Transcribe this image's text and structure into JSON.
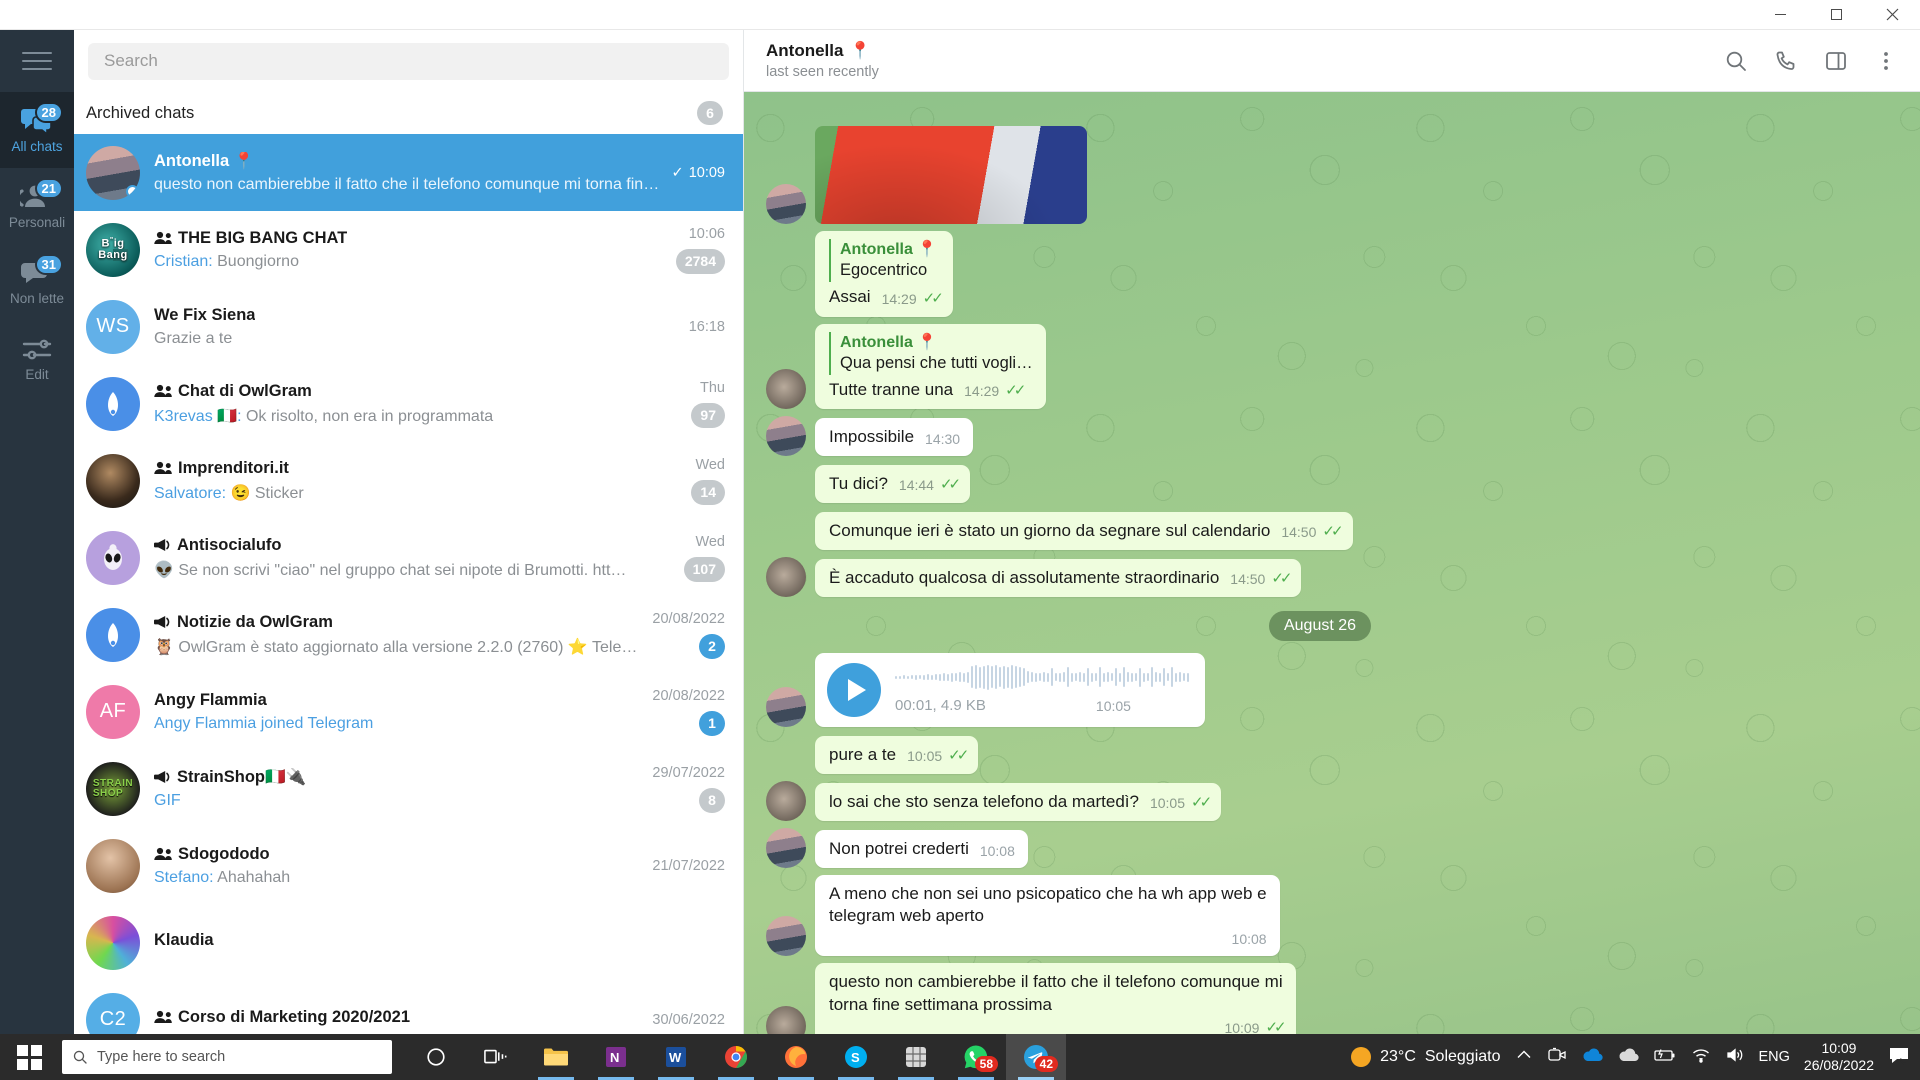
{
  "window": {
    "minimize_label": "Minimize",
    "maximize_label": "Maximize",
    "close_label": "Close"
  },
  "rail": {
    "menu_label": "Menu",
    "folders": [
      {
        "label": "All chats",
        "badge": "28",
        "icon": "chats-icon",
        "active": true
      },
      {
        "label": "Personali",
        "badge": "21",
        "icon": "person-icon",
        "active": false
      },
      {
        "label": "Non lette",
        "badge": "31",
        "icon": "unread-icon",
        "active": false
      },
      {
        "label": "Edit",
        "badge": "",
        "icon": "settings-icon",
        "active": false
      }
    ]
  },
  "search": {
    "placeholder": "Search",
    "value": ""
  },
  "archived": {
    "label": "Archived chats",
    "count": "6"
  },
  "chats": [
    {
      "name": "Antonella",
      "emoji": "📍",
      "type": "user",
      "preview": "questo non cambierebbe il fatto che il telefono comunque mi torna fine …",
      "sender": "",
      "time": "10:09",
      "badge": "",
      "badge_kind": "none",
      "selected": true,
      "read_tick": true,
      "online": true,
      "avatar_kind": "photo-antonella",
      "avatar_text": ""
    },
    {
      "name": "THE BIG BANG CHAT",
      "emoji": "",
      "type": "group",
      "preview": "Buongiorno",
      "sender": "Cristian: ",
      "time": "10:06",
      "badge": "2784",
      "badge_kind": "grey",
      "selected": false,
      "read_tick": false,
      "online": false,
      "avatar_kind": "photo-bigbang",
      "avatar_text": ""
    },
    {
      "name": "We Fix Siena",
      "emoji": "",
      "type": "user",
      "preview": "Grazie a te",
      "sender": "",
      "time": "16:18",
      "badge": "",
      "badge_kind": "none",
      "selected": false,
      "read_tick": false,
      "online": false,
      "avatar_kind": "initials-blue",
      "avatar_text": "WS"
    },
    {
      "name": "Chat di OwlGram",
      "emoji": "",
      "type": "group",
      "preview": "Ok risolto, non era in programmata",
      "sender": "K3revas 🇮🇹: ",
      "time": "Thu",
      "badge": "97",
      "badge_kind": "grey",
      "selected": false,
      "read_tick": false,
      "online": false,
      "avatar_kind": "owl",
      "avatar_text": ""
    },
    {
      "name": "Imprenditori.it",
      "emoji": "",
      "type": "group",
      "preview": "😉 Sticker",
      "sender": "Salvatore: ",
      "time": "Wed",
      "badge": "14",
      "badge_kind": "grey",
      "selected": false,
      "read_tick": false,
      "online": false,
      "avatar_kind": "photo-man",
      "avatar_text": ""
    },
    {
      "name": "Antisocialufo",
      "emoji": "",
      "type": "channel",
      "preview": "👽 Se non scrivi \"ciao\" nel gruppo chat sei nipote di Brumotti.  htt…",
      "sender": "",
      "time": "Wed",
      "badge": "107",
      "badge_kind": "grey",
      "selected": false,
      "read_tick": false,
      "online": false,
      "avatar_kind": "alien",
      "avatar_text": ""
    },
    {
      "name": "Notizie da OwlGram",
      "emoji": "",
      "type": "channel",
      "preview": "🦉 OwlGram è stato aggiornato alla versione 2.2.0 (2760) ⭐ Telegr…",
      "sender": "",
      "time": "20/08/2022",
      "badge": "2",
      "badge_kind": "blue",
      "selected": false,
      "read_tick": false,
      "online": false,
      "avatar_kind": "owl",
      "avatar_text": ""
    },
    {
      "name": "Angy Flammia",
      "emoji": "",
      "type": "user",
      "preview": "Angy Flammia joined Telegram",
      "sender": "",
      "preview_blue": true,
      "time": "20/08/2022",
      "badge": "1",
      "badge_kind": "blue",
      "selected": false,
      "read_tick": false,
      "online": false,
      "avatar_kind": "initials-pink",
      "avatar_text": "AF"
    },
    {
      "name": "StrainShop🇮🇹🔌",
      "emoji": "",
      "type": "channel",
      "preview": "GIF",
      "sender": "",
      "preview_blue": true,
      "time": "29/07/2022",
      "badge": "8",
      "badge_kind": "grey",
      "selected": false,
      "read_tick": false,
      "online": false,
      "avatar_kind": "strain",
      "avatar_text": ""
    },
    {
      "name": "Sdogododo",
      "emoji": "",
      "type": "group",
      "preview": "Ahahahah",
      "sender": "Stefano: ",
      "time": "21/07/2022",
      "badge": "",
      "badge_kind": "none",
      "selected": false,
      "read_tick": false,
      "online": false,
      "avatar_kind": "photo-head",
      "avatar_text": ""
    },
    {
      "name": "Klaudia",
      "emoji": "",
      "type": "user",
      "preview": "",
      "sender": "",
      "time": "",
      "badge": "",
      "badge_kind": "none",
      "selected": false,
      "read_tick": false,
      "online": false,
      "avatar_kind": "photo-klaudia",
      "avatar_text": ""
    },
    {
      "name": "Corso di Marketing 2020/2021",
      "emoji": "",
      "type": "group",
      "preview": "",
      "sender": "",
      "time": "30/06/2022",
      "badge": "",
      "badge_kind": "none",
      "selected": false,
      "read_tick": false,
      "online": false,
      "avatar_kind": "initials-blue2",
      "avatar_text": "C2"
    }
  ],
  "conversation": {
    "title": "Antonella",
    "title_emoji": "📍",
    "status": "last seen recently",
    "actions": [
      "search-icon",
      "phone-icon",
      "panel-icon",
      "more-icon"
    ],
    "messages": [
      {
        "kind": "photo",
        "dir": "in",
        "avatar": true
      },
      {
        "kind": "text",
        "dir": "out",
        "avatar": false,
        "reply_name": "Antonella",
        "reply_emoji": "📍",
        "reply_text": "Egocentrico",
        "text": "Assai",
        "time": "14:29",
        "ticks": true
      },
      {
        "kind": "text",
        "dir": "out",
        "avatar": true,
        "avatar_kind": "cat",
        "reply_name": "Antonella",
        "reply_emoji": "📍",
        "reply_text": "Qua pensi che tutti vogli…",
        "text": "Tutte tranne una",
        "time": "14:29",
        "ticks": true
      },
      {
        "kind": "text",
        "dir": "in",
        "avatar": true,
        "avatar_kind": "girl",
        "text": "Impossibile",
        "time": "14:30",
        "ticks": false
      },
      {
        "kind": "text",
        "dir": "out",
        "avatar": false,
        "text": "Tu dici?",
        "time": "14:44",
        "ticks": true
      },
      {
        "kind": "text",
        "dir": "out",
        "avatar": false,
        "wide": true,
        "text": "Comunque ieri è stato un giorno da segnare sul calendario",
        "time": "14:50",
        "ticks": true
      },
      {
        "kind": "text",
        "dir": "out",
        "avatar": true,
        "avatar_kind": "cat",
        "wide": true,
        "text": "È accaduto qualcosa di assolutamente straordinario",
        "time": "14:50",
        "ticks": true
      },
      {
        "kind": "date",
        "label": "August 26"
      },
      {
        "kind": "voice",
        "dir": "in",
        "avatar": true,
        "avatar_kind": "girl",
        "duration": "00:01, 4.9 KB",
        "time": "10:05"
      },
      {
        "kind": "text",
        "dir": "out",
        "avatar": false,
        "text": "pure a te",
        "time": "10:05",
        "ticks": true
      },
      {
        "kind": "text",
        "dir": "out",
        "avatar": true,
        "avatar_kind": "cat",
        "text": "lo sai che sto senza telefono da martedì?",
        "time": "10:05",
        "ticks": true
      },
      {
        "kind": "text",
        "dir": "in",
        "avatar": true,
        "avatar_kind": "girl",
        "text": "Non potrei crederti",
        "time": "10:08",
        "ticks": false
      },
      {
        "kind": "text",
        "dir": "in",
        "avatar": true,
        "avatar_kind": "girl",
        "stacked": true,
        "text": "A meno che non sei uno psicopatico che ha wh app web e\ntelegram web aperto",
        "time": "10:08",
        "ticks": false
      },
      {
        "kind": "text",
        "dir": "out",
        "avatar": true,
        "avatar_kind": "cat",
        "stacked": true,
        "text": "questo non cambierebbe il fatto che il telefono comunque mi\ntorna fine settimana prossima",
        "time": "10:09",
        "ticks": true
      }
    ]
  },
  "taskbar": {
    "start_label": "Start",
    "search_placeholder": "Type here to search",
    "items": [
      {
        "name": "cortana-icon",
        "badge": ""
      },
      {
        "name": "task-view-icon",
        "badge": ""
      },
      {
        "name": "file-explorer-icon",
        "badge": ""
      },
      {
        "name": "onenote-icon",
        "badge": ""
      },
      {
        "name": "word-icon",
        "badge": ""
      },
      {
        "name": "chrome-icon",
        "badge": ""
      },
      {
        "name": "firefox-icon",
        "badge": ""
      },
      {
        "name": "skype-icon",
        "badge": ""
      },
      {
        "name": "grid-app-icon",
        "badge": ""
      },
      {
        "name": "whatsapp-icon",
        "badge": "58"
      },
      {
        "name": "telegram-icon",
        "badge": "42"
      }
    ],
    "tray": {
      "temperature": "23°C",
      "weather": "Soleggiato",
      "language": "ENG",
      "time": "10:09",
      "date": "26/08/2022",
      "icons": [
        "chevron-up-icon",
        "webcam-icon",
        "onedrive-icon",
        "cloud-icon",
        "battery-icon",
        "wifi-icon",
        "volume-icon",
        "action-center-icon"
      ]
    }
  },
  "colors": {
    "accent_blue": "#41a0dc",
    "rail_bg": "#28343f",
    "out_bubble": "#effdde",
    "in_bubble": "#ffffff",
    "chat_bg": "#97c389",
    "tick_green": "#4fae4e"
  }
}
